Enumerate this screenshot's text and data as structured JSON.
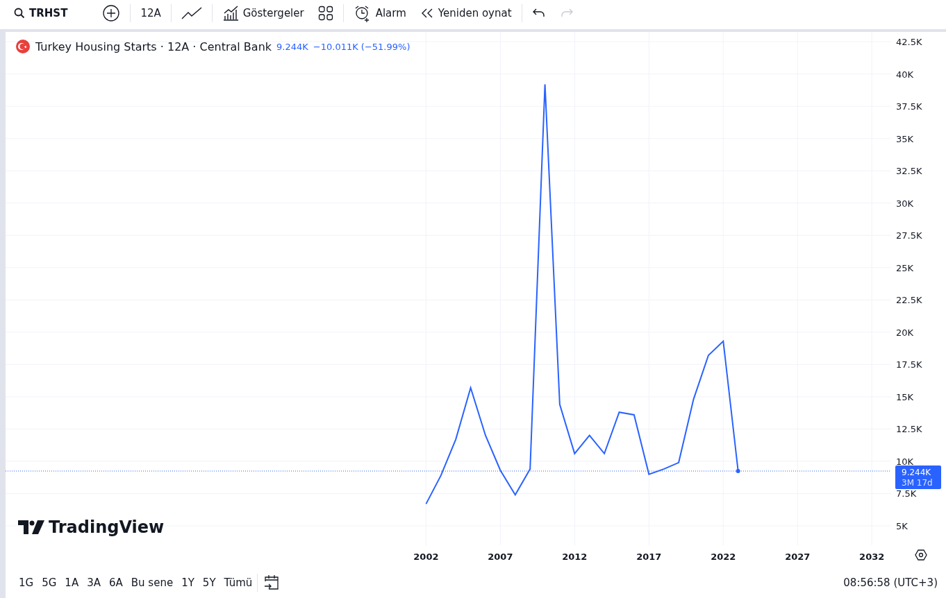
{
  "toolbar": {
    "symbol": "TRHST",
    "interval": "12A",
    "indicators": "Göstergeler",
    "alarm": "Alarm",
    "replay": "Yeniden oynat"
  },
  "legend": {
    "title": "Turkey Housing Starts · 12A · Central Bank",
    "last": "9.244K",
    "change": "−10.011K (−51.99%)"
  },
  "logo": "TradingView",
  "price_label": {
    "value": "9.244K",
    "countdown": "3M 17d"
  },
  "chart_data": {
    "type": "line",
    "x": [
      2002,
      2003,
      2004,
      2005,
      2006,
      2007,
      2008,
      2009,
      2010,
      2011,
      2012,
      2013,
      2014,
      2015,
      2016,
      2017,
      2018,
      2019,
      2020,
      2021,
      2022,
      2023
    ],
    "series": [
      {
        "color": "#2962ff",
        "values": [
          6700,
          8900,
          11700,
          15700,
          12000,
          9300,
          7400,
          9400,
          39200,
          14400,
          10600,
          12000,
          10600,
          13800,
          13600,
          9000,
          9400,
          9900,
          14800,
          18200,
          19300,
          9244
        ]
      }
    ],
    "grid": true,
    "ref_lines": [
      {
        "axis": "y",
        "value": 9244,
        "color": "#2962ff"
      }
    ],
    "xlim": [
      1973.7,
      2033.3
    ],
    "ylim": [
      3496,
      43256
    ],
    "xticks": [
      2002,
      2007,
      2012,
      2017,
      2022,
      2027,
      2032
    ],
    "yticks": [
      {
        "value": 5000,
        "label": "5K"
      },
      {
        "value": 7500,
        "label": "7.5K"
      },
      {
        "value": 10000,
        "label": "10K"
      },
      {
        "value": 12500,
        "label": "12.5K"
      },
      {
        "value": 15000,
        "label": "15K"
      },
      {
        "value": 17500,
        "label": "17.5K"
      },
      {
        "value": 20000,
        "label": "20K"
      },
      {
        "value": 22500,
        "label": "22.5K"
      },
      {
        "value": 25000,
        "label": "25K"
      },
      {
        "value": 27500,
        "label": "27.5K"
      },
      {
        "value": 30000,
        "label": "30K"
      },
      {
        "value": 32500,
        "label": "32.5K"
      },
      {
        "value": 35000,
        "label": "35K"
      },
      {
        "value": 37500,
        "label": "37.5K"
      },
      {
        "value": 40000,
        "label": "40K"
      },
      {
        "value": 42500,
        "label": "42.5K"
      }
    ]
  },
  "ranges": [
    "1G",
    "5G",
    "1A",
    "3A",
    "6A",
    "Bu sene",
    "1Y",
    "5Y",
    "Tümü"
  ],
  "time": "08:56:58 (UTC+3)"
}
